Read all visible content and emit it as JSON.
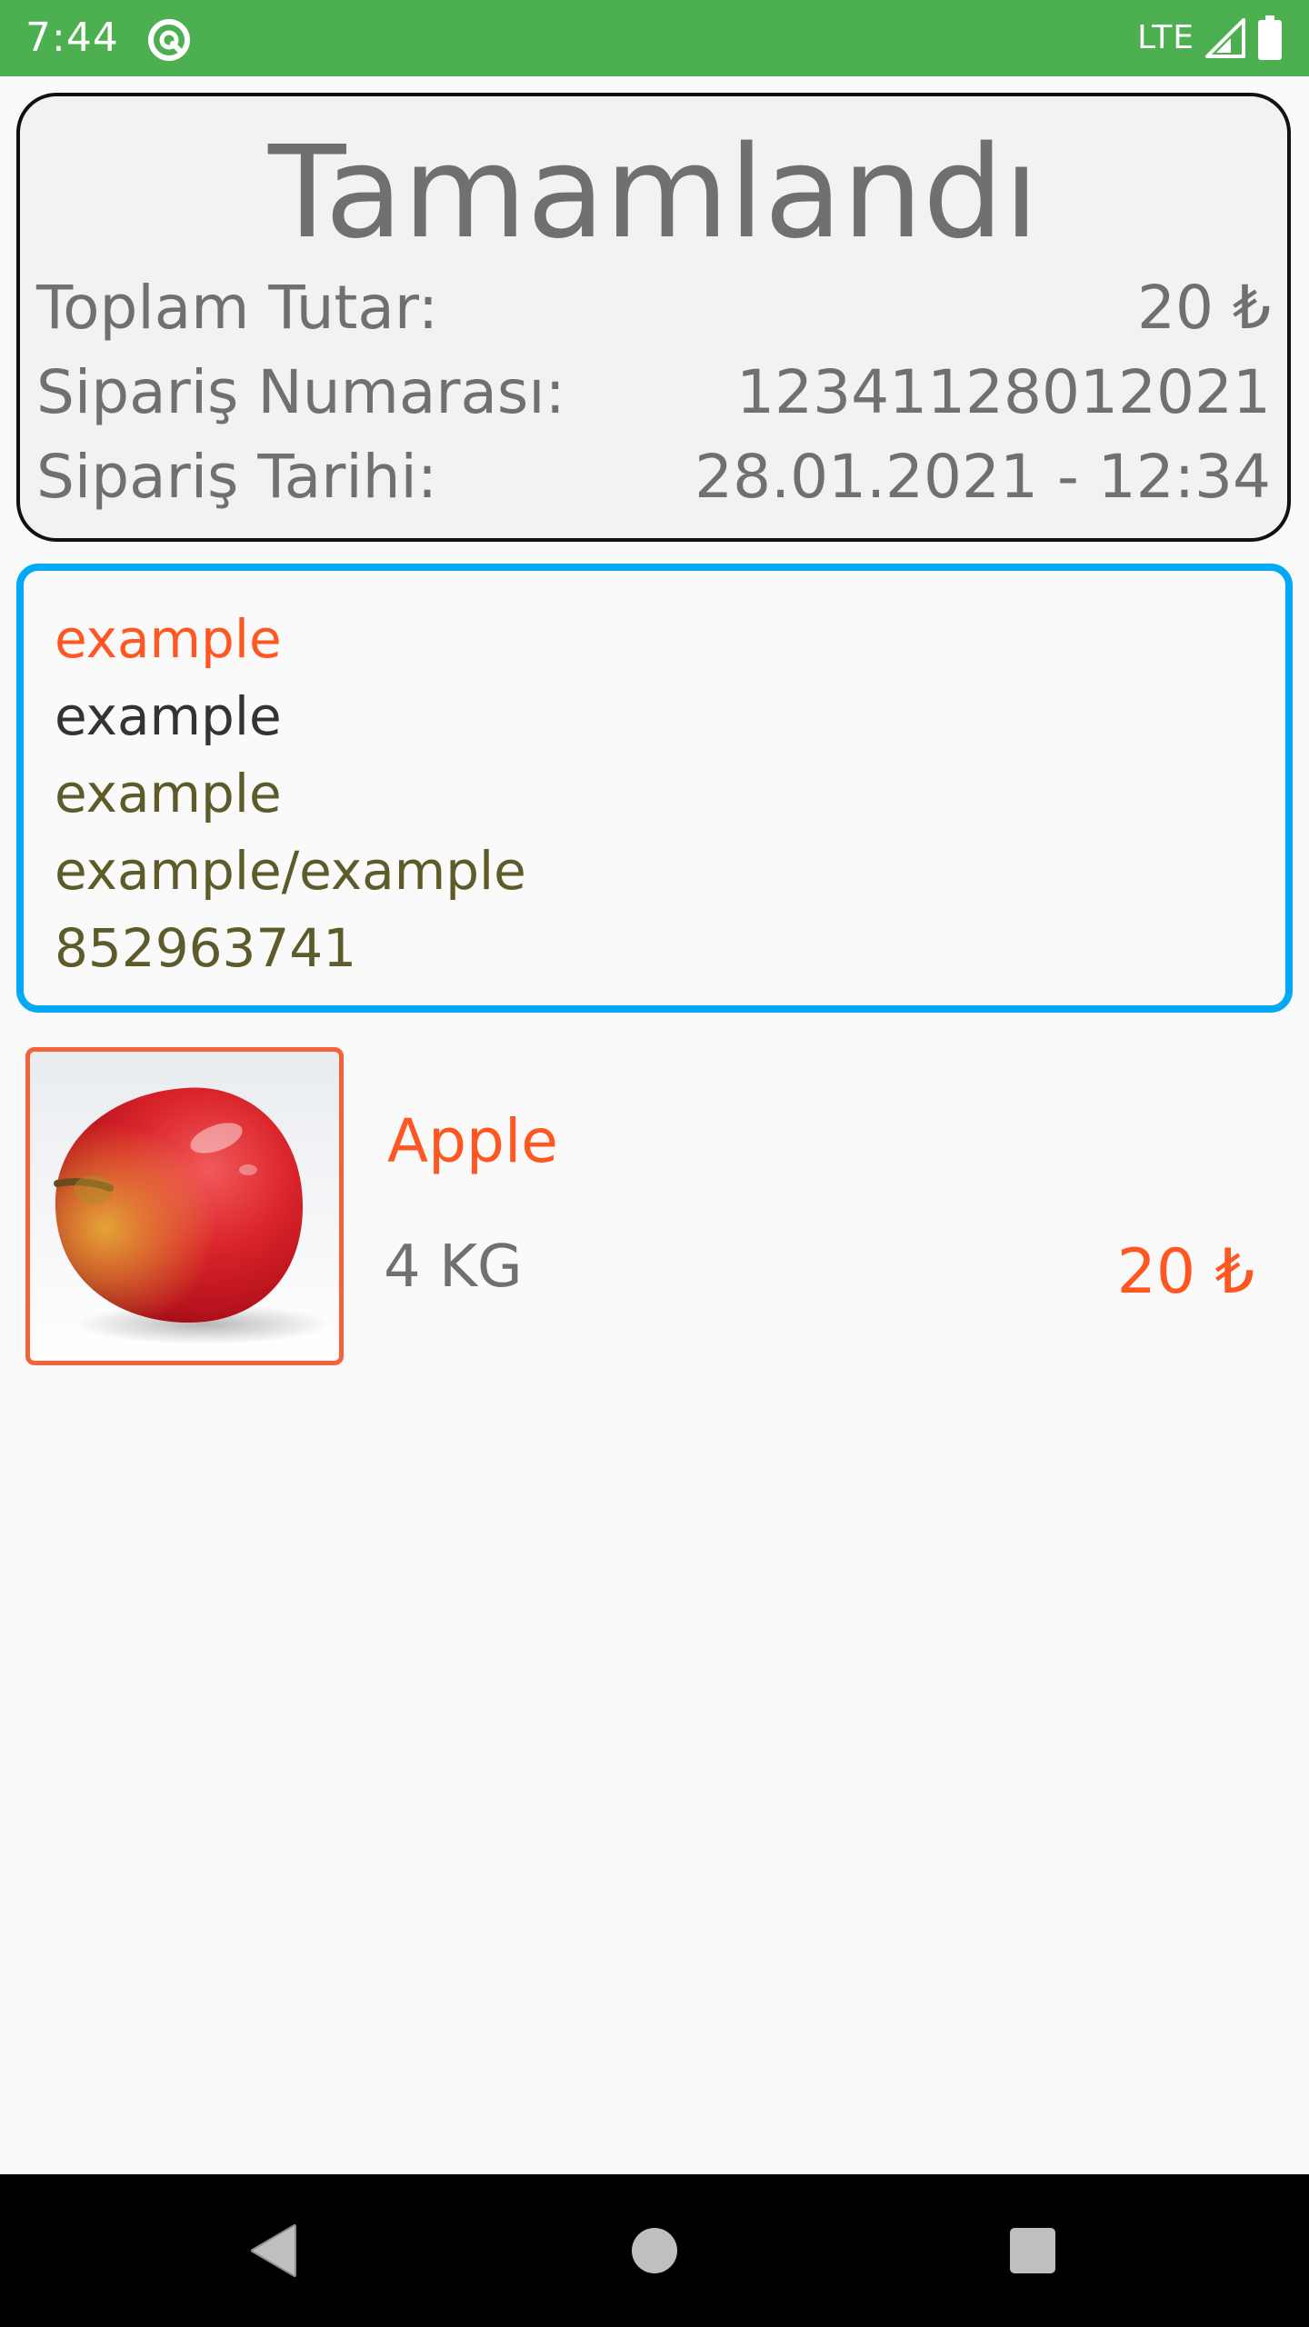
{
  "status_bar": {
    "time": "7:44",
    "network": "LTE",
    "icons": [
      "app-notification-icon",
      "signal-icon",
      "battery-icon"
    ]
  },
  "summary": {
    "status": "Tamamlandı",
    "total_label": "Toplam Tutar:",
    "total_value": "20 ₺",
    "order_number_label": "Sipariş Numarası:",
    "order_number_value": "12341128012021",
    "order_date_label": "Sipariş Tarihi:",
    "order_date_value": "28.01.2021 - 12:34"
  },
  "address": {
    "lines": [
      "example",
      "example",
      "example",
      "example/example",
      "852963741"
    ]
  },
  "product": {
    "name": "Apple",
    "quantity": "4 KG",
    "price": "20 ₺",
    "image": "apple-image"
  },
  "nav": {
    "icons": [
      "back-icon",
      "home-icon",
      "recents-icon"
    ]
  },
  "colors": {
    "status_bar": "#4caf50",
    "accent_orange": "#ff5722",
    "address_border": "#03a9f4",
    "thumb_border": "#f4623a",
    "muted_text": "#707070",
    "olive_text": "#5d5b2a"
  }
}
